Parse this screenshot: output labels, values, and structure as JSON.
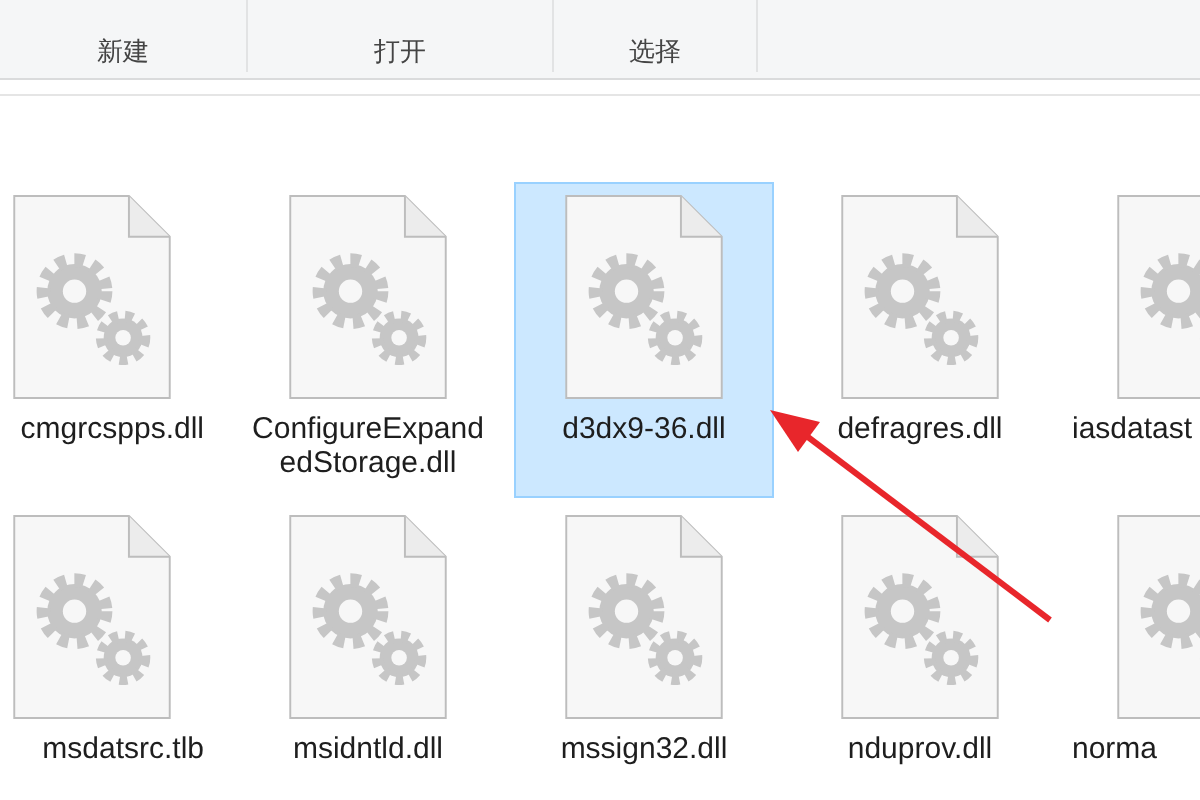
{
  "ribbon": {
    "groups": [
      {
        "label": "新建"
      },
      {
        "label": "打开"
      },
      {
        "label": "选择"
      }
    ]
  },
  "files": [
    {
      "name": "cmgrcspps.dll",
      "selected": false
    },
    {
      "name": "ConfigureExpandedStorage.dll",
      "selected": false
    },
    {
      "name": "d3dx9-36.dll",
      "selected": true
    },
    {
      "name": "defragres.dll",
      "selected": false
    },
    {
      "name": "iasdatast",
      "selected": false
    },
    {
      "name": "msdatsrc.tlb",
      "selected": false
    },
    {
      "name": "msidntld.dll",
      "selected": false
    },
    {
      "name": "mssign32.dll",
      "selected": false
    },
    {
      "name": "nduprov.dll",
      "selected": false
    },
    {
      "name": "norma",
      "selected": false
    }
  ]
}
